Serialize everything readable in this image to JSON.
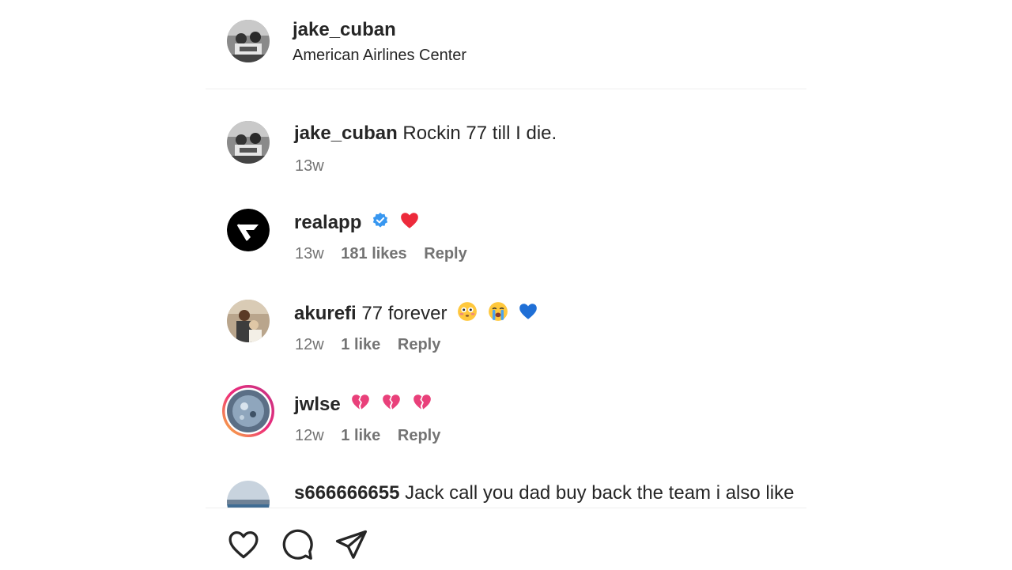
{
  "header": {
    "username": "jake_cuban",
    "location": "American Airlines Center"
  },
  "comments": [
    {
      "username": "jake_cuban",
      "text": "Rockin 77 till I die.",
      "time": "13w",
      "likes": "",
      "reply": ""
    },
    {
      "username": "realapp",
      "verified": true,
      "text": "",
      "emojis": [
        "red-heart-icon"
      ],
      "time": "13w",
      "likes": "181 likes",
      "reply": "Reply"
    },
    {
      "username": "akurefi",
      "text": "77 forever",
      "emojis": [
        "flushed-face-icon",
        "loudly-crying-face-icon",
        "blue-heart-icon"
      ],
      "time": "12w",
      "likes": "1 like",
      "reply": "Reply"
    },
    {
      "username": "jwlse",
      "text": "",
      "emojis": [
        "broken-heart-icon",
        "broken-heart-icon",
        "broken-heart-icon"
      ],
      "time": "12w",
      "likes": "1 like",
      "reply": "Reply"
    },
    {
      "username": "s666666655",
      "text": "Jack call you dad buy back the team i also like",
      "time": "",
      "likes": "",
      "reply": ""
    }
  ],
  "actions": [
    "heart-icon",
    "comment-icon",
    "share-icon"
  ],
  "colors": {
    "verified": "#3897f0",
    "meta_text": "#737373",
    "red_heart": "#ed2a3b",
    "blue_heart": "#1f6fd6",
    "broken_heart": "#e9407a"
  }
}
